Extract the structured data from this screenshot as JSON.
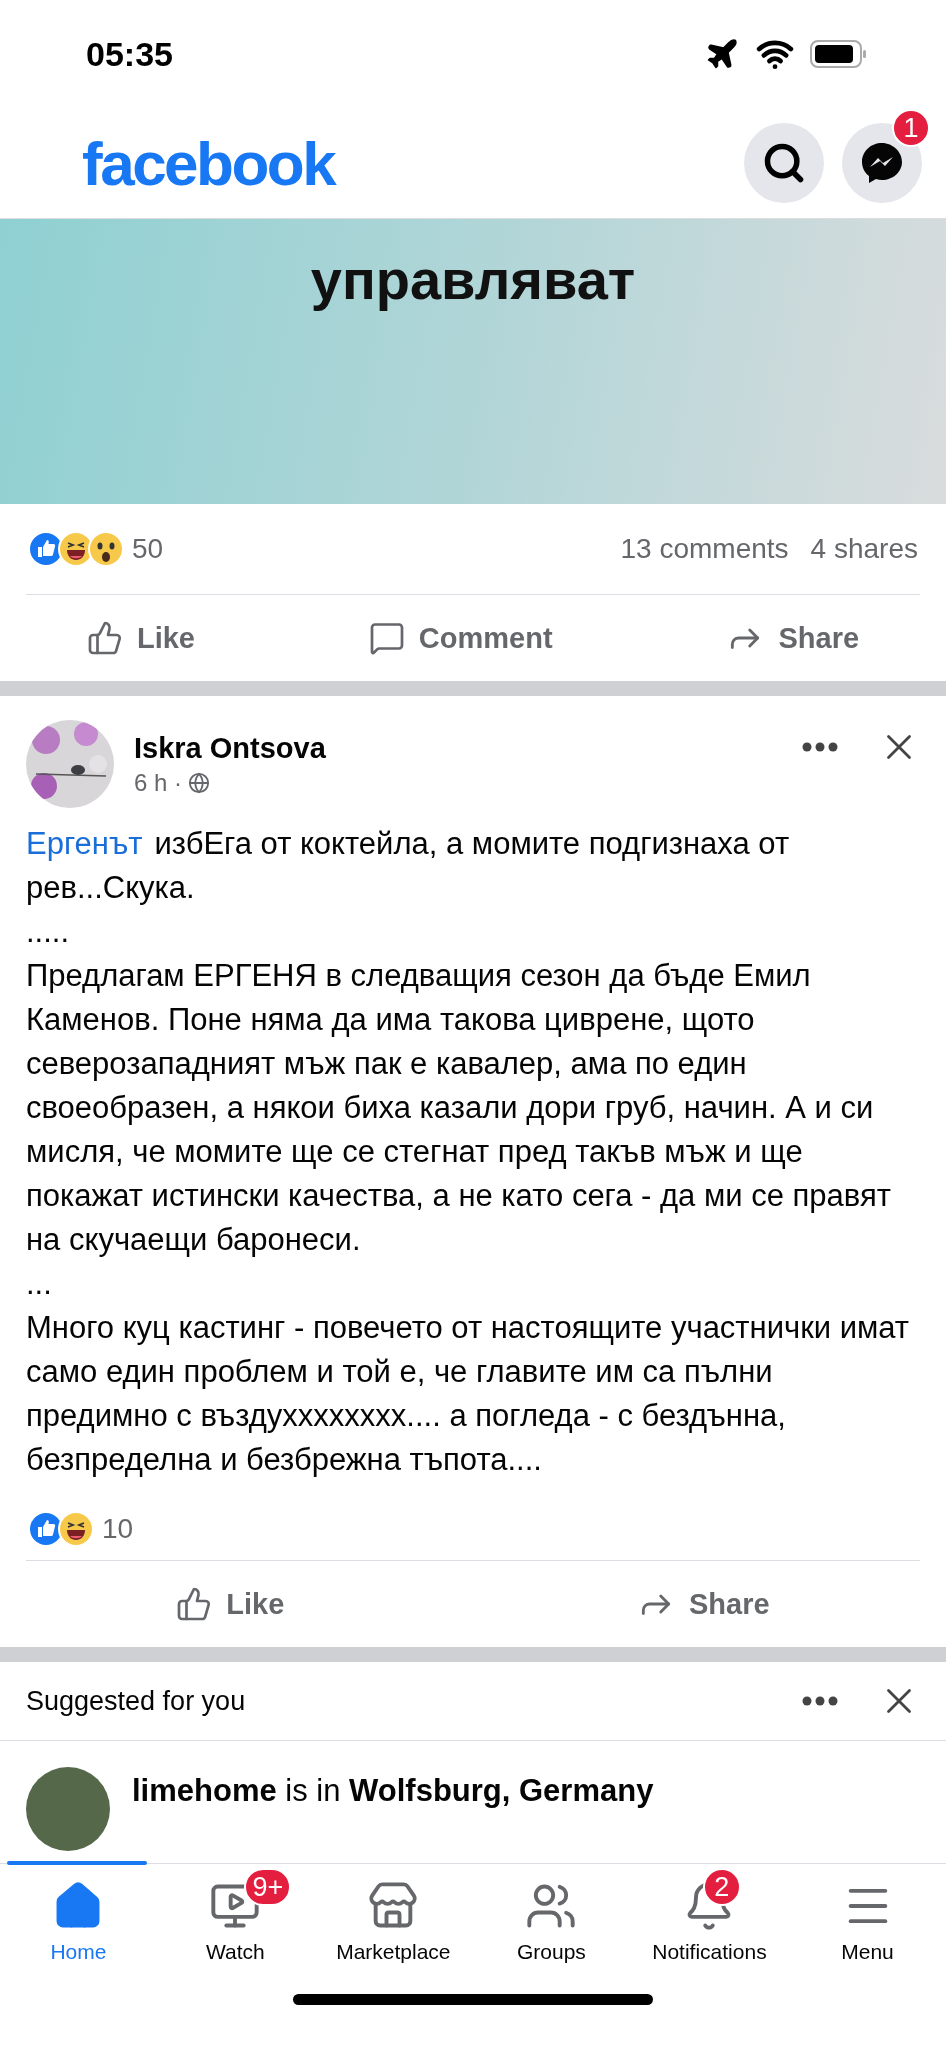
{
  "status_bar": {
    "time": "05:35"
  },
  "header": {
    "logo": "facebook",
    "messenger_badge": "1"
  },
  "posts": [
    {
      "kind": "image_post",
      "image_text": "управляват",
      "reactions": [
        {
          "kind": "like"
        },
        {
          "kind": "haha"
        },
        {
          "kind": "wow"
        }
      ],
      "reactions_count": "50",
      "comments": "13 comments",
      "shares": "4 shares",
      "actions": [
        {
          "kind": "like",
          "label": "Like"
        },
        {
          "kind": "comment",
          "label": "Comment"
        },
        {
          "kind": "share",
          "label": "Share"
        }
      ]
    },
    {
      "kind": "text_post",
      "author": "Iskra Ontsova",
      "time": "6 h ·",
      "body": [
        {
          "link": "Ергенът",
          "text": "избЕга от коктейла, а момите подгизнаха от рев...Скука."
        },
        {
          "text": "....."
        },
        {
          "text": "Предлагам ЕРГЕНЯ в следващия сезон да бъде Емил Каменов. Поне няма да има такова циврене, щото северозападният мъж пак е кавалер, ама по един своеобразен, а някои биха казали дори груб, начин. А и си мисля, че момите ще се стегнат пред такъв мъж и ще покажат истински качества, а не като сега - да ми се правят на скучаещи баронеси."
        },
        {
          "text": "..."
        },
        {
          "text": "Много куц кастинг - повечето от настоящите участнички имат само един проблем и той е, че главите им са пълни предимно с въздухххххххх.... а погледа - с бездънна, безпределна и безбрежна тъпота...."
        }
      ],
      "reactions": [
        {
          "kind": "like"
        },
        {
          "kind": "haha"
        }
      ],
      "reactions_count": "10",
      "actions": [
        {
          "kind": "like",
          "label": "Like"
        },
        {
          "kind": "share",
          "label": "Share"
        }
      ]
    }
  ],
  "suggested": {
    "title": "Suggested for you",
    "item": "**limehome** is in **Wolfsburg, Germany**"
  },
  "tab_bar": [
    {
      "kind": "home",
      "label": "Home",
      "selected": true
    },
    {
      "kind": "watch",
      "label": "Watch",
      "selected": false,
      "badge": "9+"
    },
    {
      "kind": "marketplace",
      "label": "Marketplace",
      "selected": false
    },
    {
      "kind": "groups",
      "label": "Groups",
      "selected": false
    },
    {
      "kind": "notifications",
      "label": "Notifications",
      "selected": false,
      "badge": "2"
    },
    {
      "kind": "menu",
      "label": "Menu",
      "selected": false
    }
  ]
}
